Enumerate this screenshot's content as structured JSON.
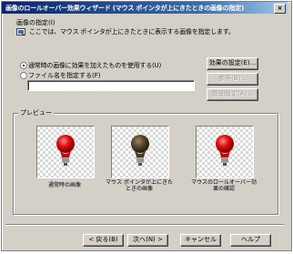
{
  "window": {
    "title": "画像のロールオーバー効果ウィザード (マウス ポインタが上にきたときの画像の指定)",
    "close": "×"
  },
  "image_spec": {
    "heading": "画像の指定(I)",
    "description": "ここでは、マウス ポインタが上にきたときに表示する画像を指定します。",
    "option_effect": "通常時の画像に効果を加えたものを使用する(U)",
    "option_file": "ファイル名を指定する(F)",
    "selected": "effect",
    "file_path_value": "",
    "effect_settings_button": "効果の設定(E)...",
    "browse_button": "参照(B)...",
    "advanced_button": "詳細設定(A)..."
  },
  "preview": {
    "label": "プレビュー",
    "items": [
      {
        "caption": "通常時の画像",
        "bulb": "red-bulb-icon"
      },
      {
        "caption": "マウス ポインタが上にきたときの画像",
        "bulb": "dark-bulb-icon"
      },
      {
        "caption": "マウスのロールオーバー効果の確認",
        "bulb": "red-bulb-icon"
      }
    ]
  },
  "buttons": {
    "back": "< 戻る(B)",
    "next": "次へ(N) >",
    "cancel": "キャンセル",
    "help": "ヘルプ"
  },
  "colors": {
    "titlebar_start": "#0a246a",
    "titlebar_end": "#a6caf0",
    "bulb_red": "#e01010",
    "bulb_dark": "#5a4a30",
    "face": "#d4d0c8"
  }
}
